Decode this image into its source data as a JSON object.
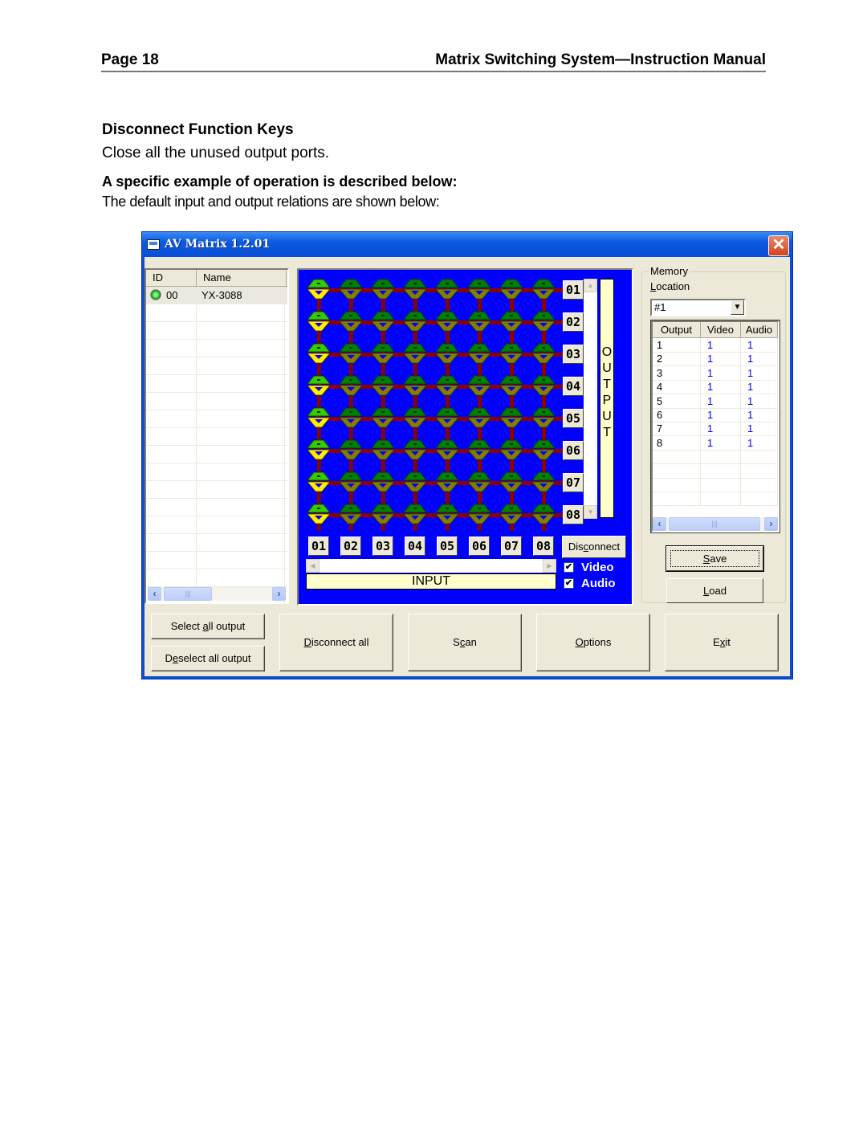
{
  "page_header": {
    "page_number": "Page 18",
    "manual_title": "Matrix Switching System—Instruction Manual"
  },
  "section": {
    "heading": "Disconnect Function Keys",
    "description": "Close all the unused output ports.",
    "example_heading": "A specific example of operation is described below:",
    "example_text": "The default input and output relations are shown below:"
  },
  "window": {
    "title": "AV Matrix 1.2.01",
    "close_glyph": "✕",
    "device_list": {
      "columns": [
        "ID",
        "Name"
      ],
      "rows": [
        {
          "id": "00",
          "name": "YX-3088",
          "status": "online"
        }
      ],
      "scroll_left": "‹",
      "scroll_right": "›",
      "thumb_glyph": "|||"
    },
    "matrix": {
      "inputs": [
        "01",
        "02",
        "03",
        "04",
        "05",
        "06",
        "07",
        "08"
      ],
      "outputs": [
        "01",
        "02",
        "03",
        "04",
        "05",
        "06",
        "07",
        "08"
      ],
      "active_input_per_output": [
        1,
        1,
        1,
        1,
        1,
        1,
        1,
        1
      ],
      "output_label_letters": [
        "O",
        "U",
        "T",
        "P",
        "U",
        "T"
      ],
      "input_label": "INPUT",
      "disconnect_label_pre": "Dis",
      "disconnect_label_ul": "c",
      "disconnect_label_post": "onnect",
      "video_label": "Video",
      "audio_label": "Audio",
      "video_checked": true,
      "audio_checked": true,
      "check_glyph": "✔",
      "up_arrow": "▲",
      "down_arrow": "▼",
      "left_arrow": "◀",
      "right_arrow": "▶",
      "colors": {
        "background": "#0000ff",
        "wire": "#8b0000",
        "active_top": "#33cc00",
        "active_bottom": "#ffee00",
        "inactive_top": "#008000",
        "inactive_bottom": "#808000"
      }
    },
    "memory": {
      "group_label": "Memory",
      "location_label_ul": "L",
      "location_label_rest": "ocation",
      "location_value": "#1",
      "dropdown_glyph": "▼",
      "columns": [
        "Output",
        "Video",
        "Audio"
      ],
      "rows": [
        {
          "output": "1",
          "video": "1",
          "audio": "1"
        },
        {
          "output": "2",
          "video": "1",
          "audio": "1"
        },
        {
          "output": "3",
          "video": "1",
          "audio": "1"
        },
        {
          "output": "4",
          "video": "1",
          "audio": "1"
        },
        {
          "output": "5",
          "video": "1",
          "audio": "1"
        },
        {
          "output": "6",
          "video": "1",
          "audio": "1"
        },
        {
          "output": "7",
          "video": "1",
          "audio": "1"
        },
        {
          "output": "8",
          "video": "1",
          "audio": "1"
        }
      ],
      "save_ul": "S",
      "save_rest": "ave",
      "load_ul": "L",
      "load_rest": "oad"
    },
    "buttons": {
      "select_all_pre": "Select ",
      "select_all_ul": "a",
      "select_all_post": "ll output",
      "deselect_all_pre": "D",
      "deselect_all_ul": "e",
      "deselect_all_post": "select all output",
      "disconnect_all_ul": "D",
      "disconnect_all_post": "isconnect all",
      "scan_pre": "S",
      "scan_ul": "c",
      "scan_post": "an",
      "options_ul": "O",
      "options_post": "ptions",
      "exit_pre": "E",
      "exit_ul": "x",
      "exit_post": "it"
    }
  }
}
